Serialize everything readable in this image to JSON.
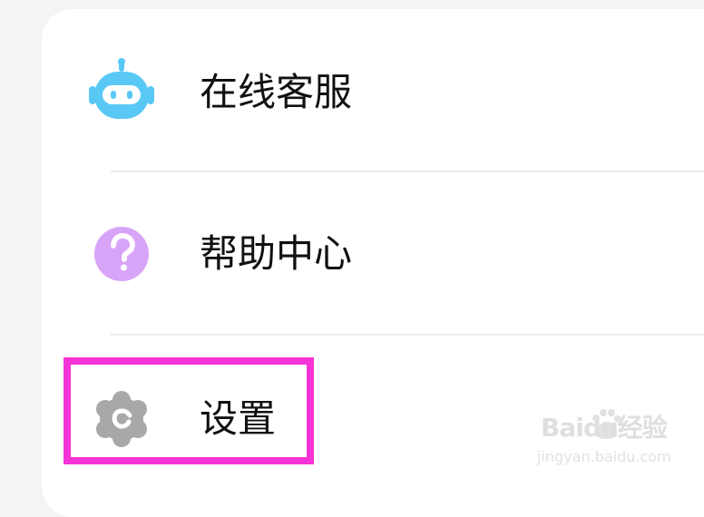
{
  "menu": {
    "items": [
      {
        "label": "在线客服",
        "icon": "robot-icon",
        "icon_color": "#59c8f5"
      },
      {
        "label": "帮助中心",
        "icon": "question-icon",
        "icon_color": "#d8a4f8"
      },
      {
        "label": "设置",
        "icon": "gear-icon",
        "icon_color": "#aaa7ab"
      }
    ]
  },
  "watermark": {
    "main": "Baidu经验",
    "sub": "jingyan.baidu.com"
  },
  "colors": {
    "background": "#f4f4f6",
    "card": "#ffffff",
    "highlight": "#f533d6",
    "divider": "#ececee",
    "text": "#111111"
  }
}
